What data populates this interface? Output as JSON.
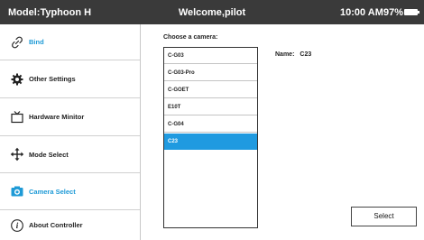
{
  "header": {
    "model": "Model:Typhoon H",
    "welcome": "Welcome,pilot",
    "time": "10:00 AM",
    "battery": "97%"
  },
  "sidebar": {
    "items": [
      {
        "label": "Bind",
        "icon": "link-icon",
        "active": true
      },
      {
        "label": "Other Settings",
        "icon": "gear-icon",
        "active": false
      },
      {
        "label": "Hardware Minitor",
        "icon": "monitor-icon",
        "active": false
      },
      {
        "label": "Mode Select",
        "icon": "move-arrows-icon",
        "active": false
      },
      {
        "label": "Camera Select",
        "icon": "camera-icon",
        "active": true
      },
      {
        "label": "About Controller",
        "icon": "info-icon",
        "active": false
      }
    ]
  },
  "main": {
    "choose_label": "Choose a camera:",
    "cameras": [
      "C-G03",
      "C-G03-Pro",
      "C-GOET",
      "E10T",
      "C-G04",
      "C23"
    ],
    "selected_camera": "C23",
    "name_label": "Name:",
    "name_value": "C23",
    "select_button": "Select"
  },
  "colors": {
    "accent": "#1e9ad6",
    "topbar": "#3a3a3a"
  }
}
